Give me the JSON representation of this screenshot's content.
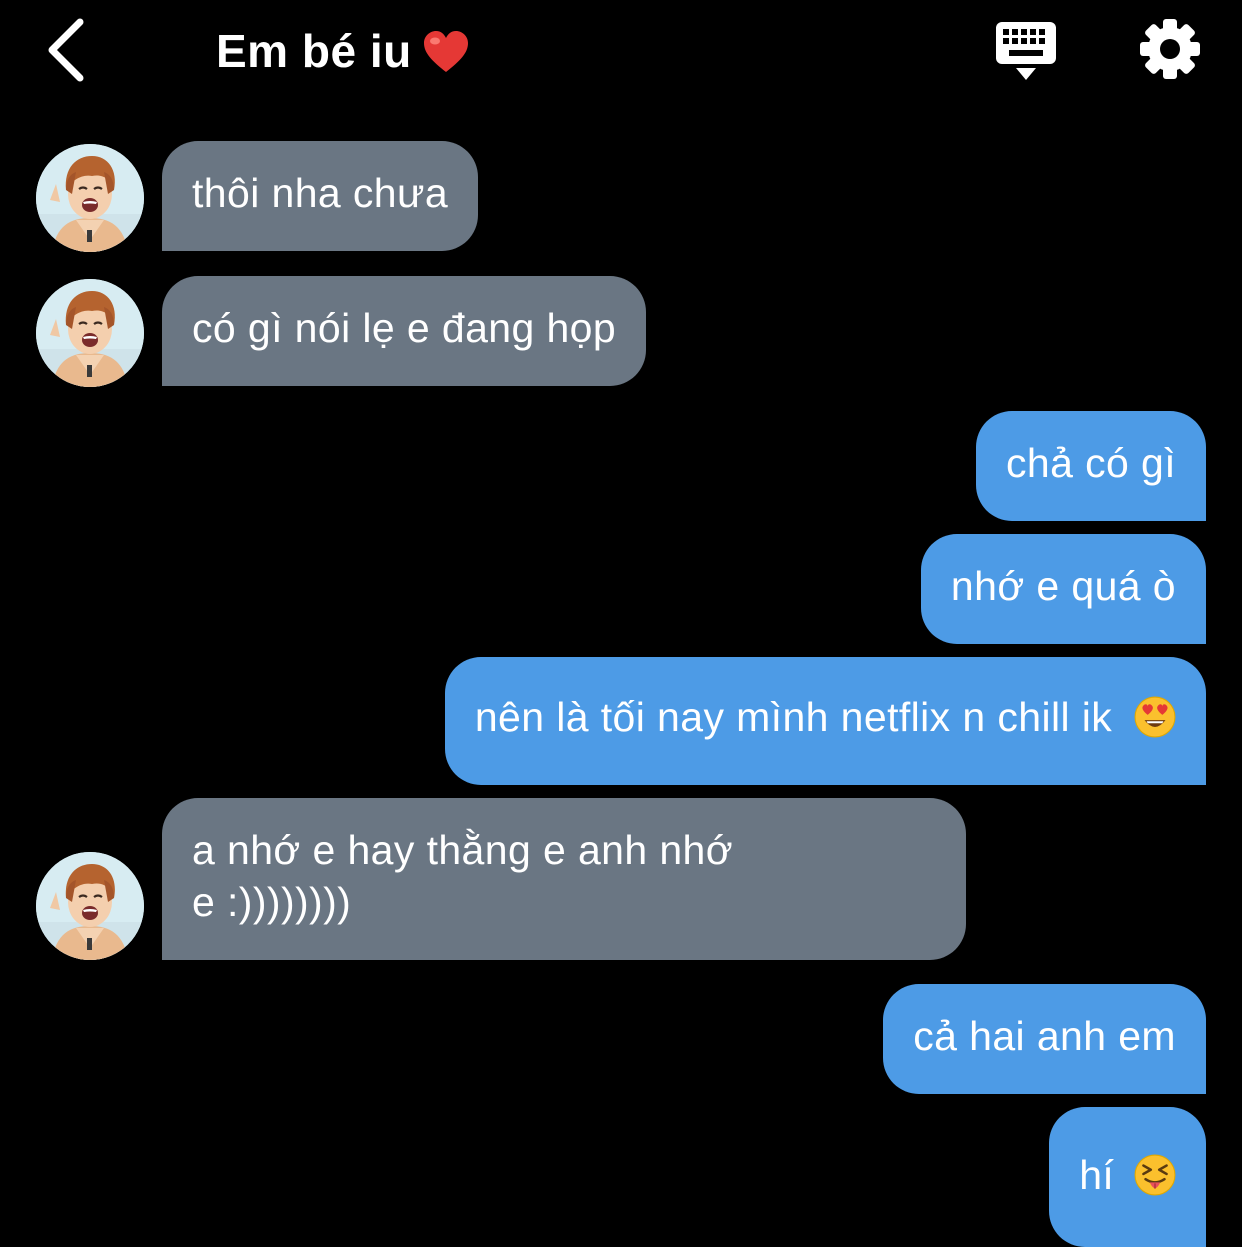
{
  "header": {
    "title": "Em bé iu",
    "back_icon": "chevron-left-icon",
    "keyboard_icon": "keyboard-icon",
    "settings_icon": "gear-icon"
  },
  "messages": [
    {
      "from": "them",
      "text": "thôi nha chưa"
    },
    {
      "from": "them",
      "text": "có gì nói lẹ e đang họp"
    },
    {
      "from": "me",
      "text": "chả có gì"
    },
    {
      "from": "me",
      "text": "nhớ e quá ò"
    },
    {
      "from": "me",
      "text": "nên là tối nay mình netflix n chill ik",
      "emoji": "heart-eyes-emoji"
    },
    {
      "from": "them",
      "line1": "a nhớ e hay thằng e anh nhớ",
      "line2": "e :))))))))"
    },
    {
      "from": "me",
      "text": "cả hai anh em"
    },
    {
      "from": "me",
      "text": "hí",
      "emoji": "squinting-tongue-emoji"
    }
  ],
  "colors": {
    "background": "#000000",
    "received_bubble": "#6a7683",
    "sent_bubble": "#4d9be6",
    "text": "#ffffff"
  }
}
